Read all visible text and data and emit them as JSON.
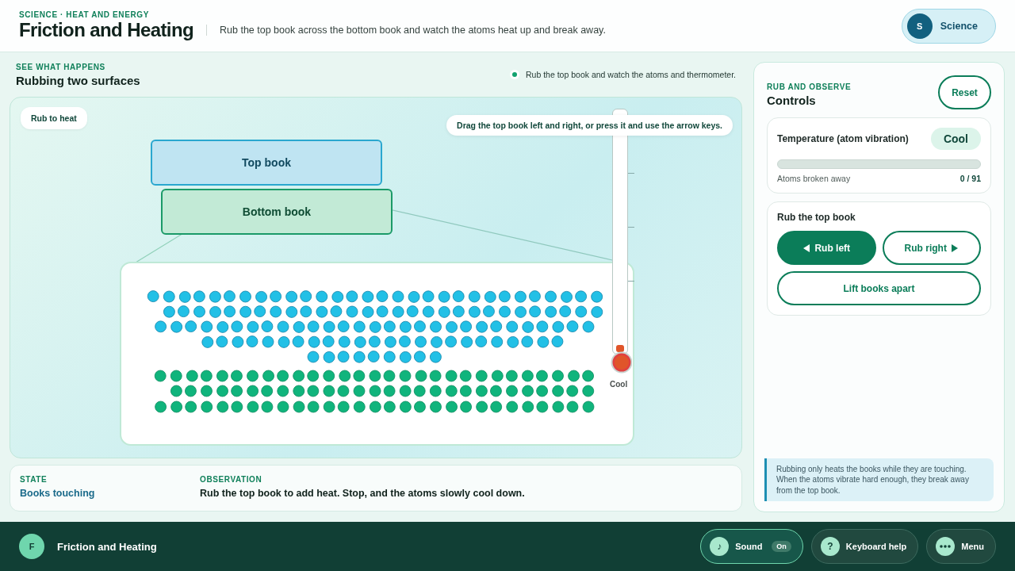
{
  "header": {
    "eyebrow": "SCIENCE · HEAT AND ENERGY",
    "title": "Friction and Heating",
    "description": "Rub the top book across the bottom book and watch the atoms heat up and break away.",
    "badge": {
      "initial": "S",
      "label": "Science"
    }
  },
  "stage": {
    "eyebrow": "SEE WHAT HAPPENS",
    "title": "Rubbing two surfaces",
    "hint": "Rub the top book and watch the atoms and thermometer.",
    "tag": "Rub to heat",
    "drag_tip": "Drag the top book left and right, or press it and use the arrow keys.",
    "top_book": "Top book",
    "bottom_book": "Bottom book",
    "thermometer": {
      "label": "Cool",
      "level": 0.03
    }
  },
  "status": {
    "state_label": "STATE",
    "state": "Books touching",
    "observation_label": "OBSERVATION",
    "observation": "Rub the top book to add heat. Stop, and the atoms slowly cool down."
  },
  "controls": {
    "eyebrow": "RUB AND OBSERVE",
    "title": "Controls",
    "reset": "Reset",
    "temperature": {
      "label": "Temperature (atom vibration)",
      "badge": "Cool",
      "level": 0,
      "broken_label": "Atoms broken away",
      "broken_value": "0 / 91"
    },
    "rub": {
      "title": "Rub the top book",
      "buttons": [
        {
          "label": "Rub left",
          "kind": "left",
          "selected": true
        },
        {
          "label": "Rub right",
          "kind": "right",
          "selected": false
        }
      ],
      "lift": "Lift books apart"
    },
    "note": "Rubbing only heats the books while they are touching. When the atoms vibrate hard enough, they break away from the top book."
  },
  "footer": {
    "initial": "F",
    "title": "Friction and Heating",
    "buttons": [
      {
        "kind": "sound",
        "label": "Sound",
        "glyph": "♪",
        "toggle": "On",
        "on": true
      },
      {
        "kind": "help",
        "label": "Keyboard help",
        "glyph": "?"
      },
      {
        "kind": "menu",
        "label": "Menu"
      }
    ]
  }
}
